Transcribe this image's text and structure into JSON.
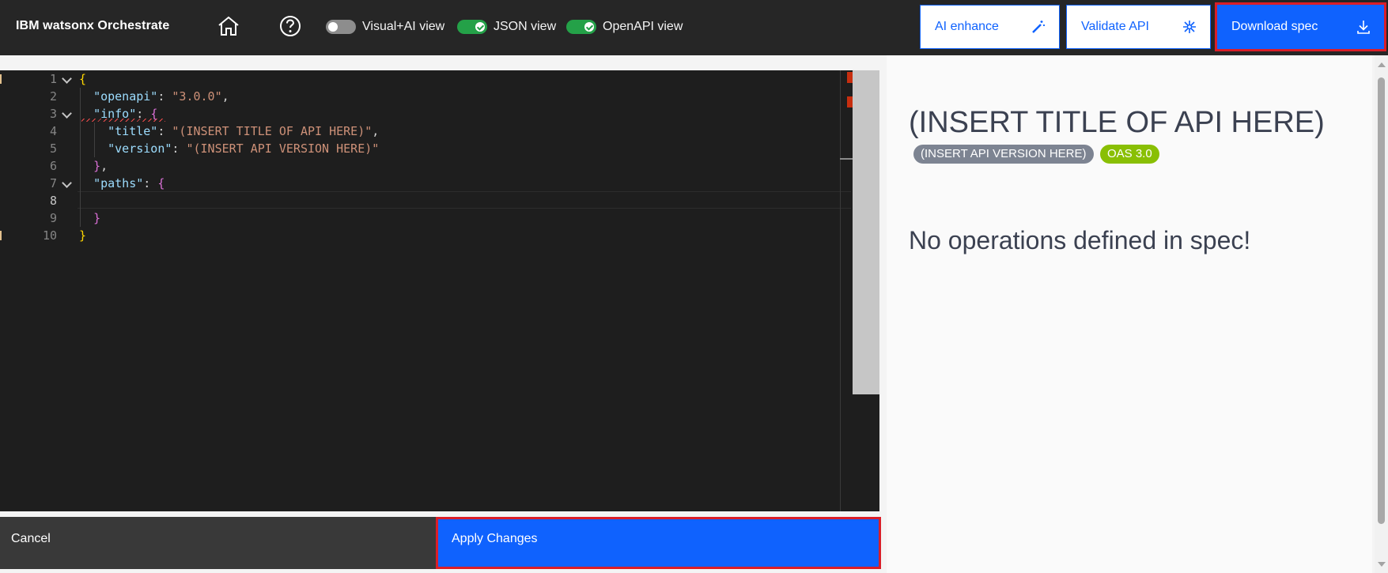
{
  "header": {
    "brand": "IBM watsonx Orchestrate",
    "home_icon": "home-icon",
    "help_icon": "help-icon",
    "toggles": [
      {
        "label": "Visual+AI view",
        "on": false
      },
      {
        "label": "JSON view",
        "on": true
      },
      {
        "label": "OpenAPI view",
        "on": true
      }
    ],
    "ai_enhance_label": "AI enhance",
    "ai_enhance_icon": "magic-wand-icon",
    "validate_label": "Validate API",
    "validate_icon": "validate-icon",
    "download_label": "Download spec",
    "download_icon": "download-icon"
  },
  "editor": {
    "lines": [
      {
        "n": "1",
        "fold": true,
        "tokens": [
          [
            "{",
            "b1"
          ]
        ]
      },
      {
        "n": "2",
        "fold": false,
        "tokens": [
          [
            "  ",
            "punc"
          ],
          [
            "\"openapi\"",
            "key"
          ],
          [
            ": ",
            "punc"
          ],
          [
            "\"3.0.0\"",
            "str"
          ],
          [
            ",",
            "punc"
          ]
        ]
      },
      {
        "n": "3",
        "fold": true,
        "tokens": [
          [
            "  ",
            "punc"
          ],
          [
            "\"info\"",
            "key"
          ],
          [
            ": ",
            "punc"
          ],
          [
            "{",
            "b2"
          ]
        ]
      },
      {
        "n": "4",
        "fold": false,
        "tokens": [
          [
            "    ",
            "punc"
          ],
          [
            "\"title\"",
            "key"
          ],
          [
            ": ",
            "punc"
          ],
          [
            "\"(INSERT TITLE OF API HERE)\"",
            "str"
          ],
          [
            ",",
            "punc"
          ]
        ]
      },
      {
        "n": "5",
        "fold": false,
        "tokens": [
          [
            "    ",
            "punc"
          ],
          [
            "\"version\"",
            "key"
          ],
          [
            ": ",
            "punc"
          ],
          [
            "\"(INSERT API VERSION HERE)\"",
            "str"
          ]
        ]
      },
      {
        "n": "6",
        "fold": false,
        "tokens": [
          [
            "  ",
            "punc"
          ],
          [
            "}",
            "b2"
          ],
          [
            ",",
            "punc"
          ]
        ]
      },
      {
        "n": "7",
        "fold": true,
        "tokens": [
          [
            "  ",
            "punc"
          ],
          [
            "\"paths\"",
            "key"
          ],
          [
            ": ",
            "punc"
          ],
          [
            "{",
            "b2"
          ]
        ]
      },
      {
        "n": "8",
        "fold": false,
        "active": true,
        "tokens": []
      },
      {
        "n": "9",
        "fold": false,
        "tokens": [
          [
            "  ",
            "punc"
          ],
          [
            "}",
            "b2"
          ]
        ]
      },
      {
        "n": "10",
        "fold": false,
        "tokens": [
          [
            "}",
            "b1"
          ]
        ]
      }
    ]
  },
  "footer": {
    "cancel_label": "Cancel",
    "apply_label": "Apply Changes"
  },
  "preview": {
    "title": "(INSERT TITLE OF API HERE)",
    "version_badge": "(INSERT API VERSION HERE)",
    "oas_badge": "OAS 3.0",
    "empty_message": "No operations defined in spec!"
  },
  "colors": {
    "primary": "#0f62fe",
    "highlight_outline": "#da1e28",
    "toggle_on": "#24a148",
    "oas_badge": "#89bf04"
  }
}
